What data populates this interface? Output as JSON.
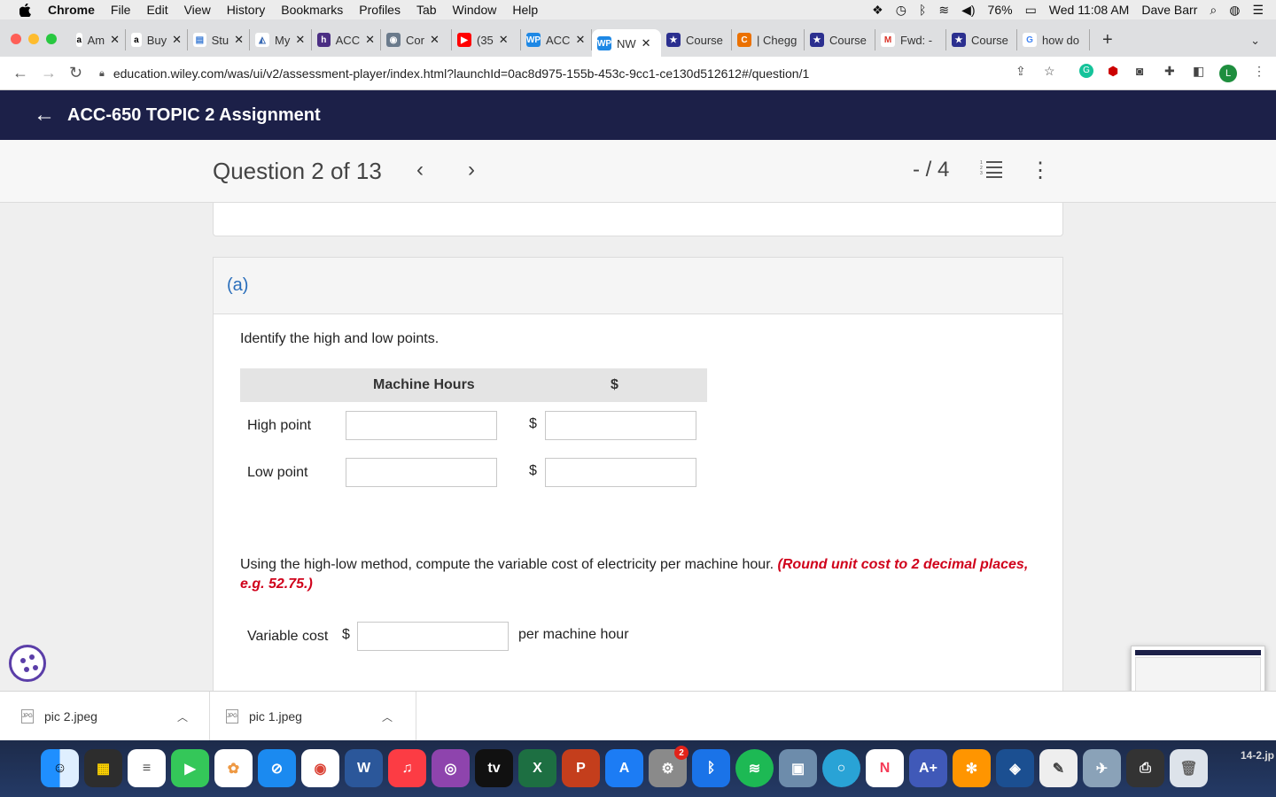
{
  "menubar": {
    "app": "Chrome",
    "items": [
      "File",
      "Edit",
      "View",
      "History",
      "Bookmarks",
      "Profiles",
      "Tab",
      "Window",
      "Help"
    ],
    "battery": "76%",
    "clock": "Wed 11:08 AM",
    "user": "Dave Barr"
  },
  "tabs": [
    {
      "icon": "a",
      "label": "Am",
      "color": "#ffffff",
      "fg": "#000000"
    },
    {
      "icon": "a",
      "label": "Buy",
      "color": "#ffffff",
      "fg": "#000000"
    },
    {
      "icon": "▤",
      "label": "Stu",
      "color": "#ffffff",
      "fg": "#3a7bd5"
    },
    {
      "icon": "◭",
      "label": "My",
      "color": "#ffffff",
      "fg": "#3a6bb5"
    },
    {
      "icon": "h",
      "label": "ACC",
      "color": "#4b2e83",
      "fg": "#ffffff"
    },
    {
      "icon": "◉",
      "label": "Cor",
      "color": "#6b7b8c",
      "fg": "#ffffff"
    },
    {
      "icon": "▶",
      "label": "(35",
      "color": "#ff0000",
      "fg": "#ffffff"
    },
    {
      "icon": "WP",
      "label": "ACC",
      "color": "#1e88e5",
      "fg": "#ffffff"
    },
    {
      "icon": "WP",
      "label": "NW",
      "color": "#1e88e5",
      "fg": "#ffffff",
      "active": true
    },
    {
      "icon": "★",
      "label": "Course",
      "color": "#2b2f8f",
      "fg": "#ffffff"
    },
    {
      "icon": "C",
      "label": "| Chegg",
      "color": "#eb7100",
      "fg": "#ffffff"
    },
    {
      "icon": "★",
      "label": "Course",
      "color": "#2b2f8f",
      "fg": "#ffffff"
    },
    {
      "icon": "M",
      "label": "Fwd: -",
      "color": "#ffffff",
      "fg": "#d93025"
    },
    {
      "icon": "★",
      "label": "Course",
      "color": "#2b2f8f",
      "fg": "#ffffff"
    },
    {
      "icon": "G",
      "label": "how do",
      "color": "#ffffff",
      "fg": "#4285f4"
    }
  ],
  "address": {
    "url": "education.wiley.com/was/ui/v2/assessment-player/index.html?launchId=0ac8d975-155b-453c-9cc1-ce130d512612#/question/1"
  },
  "appbar": {
    "title": "ACC-650 TOPIC 2 Assignment"
  },
  "question": {
    "title": "Question 2 of 13",
    "score": "- / 4"
  },
  "part": {
    "label": "(a)",
    "instruction": "Identify the high and low points.",
    "table": {
      "col1": "Machine Hours",
      "col2": "$",
      "rows": [
        {
          "label": "High point",
          "hours": "",
          "dollar_sign": "$",
          "amount": ""
        },
        {
          "label": "Low point",
          "hours": "",
          "dollar_sign": "$",
          "amount": ""
        }
      ]
    },
    "compute_text": "Using the high-low method, compute the variable cost of electricity per machine hour.",
    "compute_note": "(Round unit cost to 2 decimal places, e.g. 52.75.)",
    "variable_label": "Variable cost",
    "variable_dollar": "$",
    "variable_value": "",
    "variable_unit": "per machine hour"
  },
  "downloads": [
    {
      "name": "pic 2.jpeg"
    },
    {
      "name": "pic 1.jpeg"
    }
  ],
  "dock": {
    "mail_badge": "2",
    "label_fragment": "14-2.jp"
  }
}
